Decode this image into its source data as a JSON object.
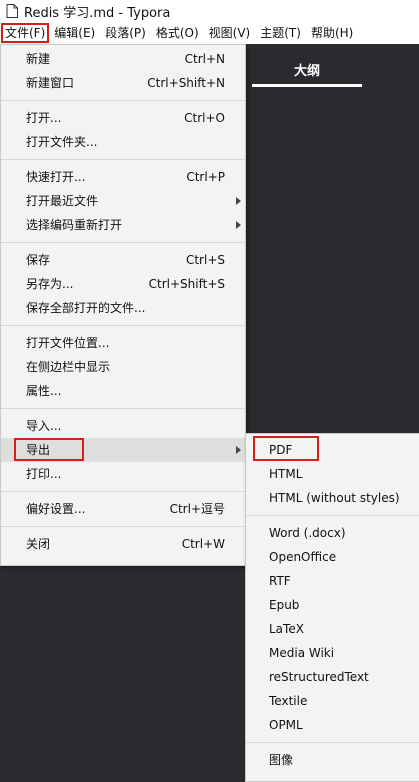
{
  "window": {
    "title": "Redis 学习.md - Typora"
  },
  "menubar": {
    "items": [
      "文件(F)",
      "编辑(E)",
      "段落(P)",
      "格式(O)",
      "视图(V)",
      "主题(T)",
      "帮助(H)"
    ]
  },
  "sidebar": {
    "outline_tab": "大纲"
  },
  "file_menu": {
    "new": "新建",
    "new_sc": "Ctrl+N",
    "new_window": "新建窗口",
    "new_window_sc": "Ctrl+Shift+N",
    "open": "打开...",
    "open_sc": "Ctrl+O",
    "open_folder": "打开文件夹...",
    "quick_open": "快速打开...",
    "quick_open_sc": "Ctrl+P",
    "open_recent": "打开最近文件",
    "reopen_encoding": "选择编码重新打开",
    "save": "保存",
    "save_sc": "Ctrl+S",
    "save_as": "另存为...",
    "save_as_sc": "Ctrl+Shift+S",
    "save_all": "保存全部打开的文件...",
    "open_location": "打开文件位置...",
    "show_sidebar": "在侧边栏中显示",
    "properties": "属性...",
    "import": "导入...",
    "export": "导出",
    "print": "打印...",
    "preferences": "偏好设置...",
    "preferences_sc": "Ctrl+逗号",
    "close": "关闭",
    "close_sc": "Ctrl+W"
  },
  "export_menu": {
    "items": [
      "PDF",
      "HTML",
      "HTML (without styles)",
      "Word (.docx)",
      "OpenOffice",
      "RTF",
      "Epub",
      "LaTeX",
      "Media Wiki",
      "reStructuredText",
      "Textile",
      "OPML",
      "图像"
    ]
  },
  "colors": {
    "highlight_box": "#d91c1c",
    "editor_bg": "#2a2b2e",
    "menu_bg": "#f3f3f3"
  }
}
